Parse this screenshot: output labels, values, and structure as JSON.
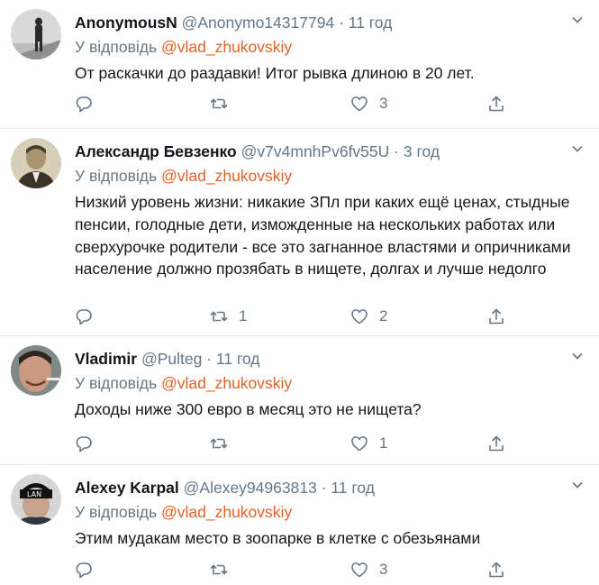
{
  "labels": {
    "reply_prefix": "У відповідь"
  },
  "colors": {
    "mention": "#e0632b",
    "secondary": "#657786",
    "divider": "#e6ecf0"
  },
  "icons": [
    "reply-icon",
    "retweet-icon",
    "like-icon",
    "share-icon",
    "chevron-down-icon"
  ],
  "tweets": [
    {
      "name": "AnonymousN",
      "handle": "@Anonymo14317794",
      "dot": "·",
      "time": "11 год",
      "reply_to": "@vlad_zhukovskiy",
      "text": "От раскачки до раздавки! Итог рывка длиною в 20 лет.",
      "retweets": "",
      "likes": "3"
    },
    {
      "name": "Александр Бевзенко",
      "handle": "@v7v4mnhPv6fv55U",
      "dot": "·",
      "time": "3 год",
      "reply_to": "@vlad_zhukovskiy",
      "text": "Низкий уровень жизни: никакие ЗПл при каких  ещё ценах, стыдные пенсии, голодные дети, изможденные на нескольких работах или сверхурочке родители - все это загнанное властями и опричниками население должно прозябать в нищете, долгах и лучше недолго",
      "retweets": "1",
      "likes": "2"
    },
    {
      "name": "Vladimir",
      "handle": "@Pulteg",
      "dot": "·",
      "time": "11 год",
      "reply_to": "@vlad_zhukovskiy",
      "text": "Доходы ниже 300 евро в месяц это не нищета?",
      "retweets": "",
      "likes": "1"
    },
    {
      "name": "Alexey Karpal",
      "handle": "@Alexey94963813",
      "dot": "·",
      "time": "11 год",
      "reply_to": "@vlad_zhukovskiy",
      "text": "Этим мудакам место в зоопарке в клетке с обезьянами",
      "retweets": "",
      "likes": "3"
    }
  ]
}
